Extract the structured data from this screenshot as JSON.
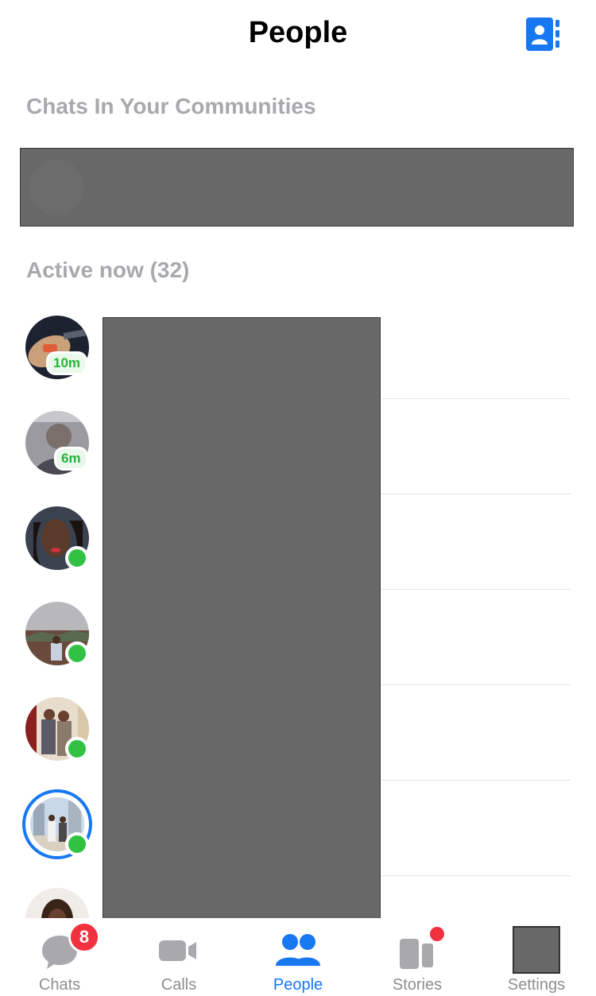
{
  "header": {
    "title": "People"
  },
  "communities": {
    "title": "Chats In Your Communities"
  },
  "active": {
    "title": "Active now (32)",
    "people": [
      {
        "status": "time",
        "time": "10m"
      },
      {
        "status": "time",
        "time": "6m"
      },
      {
        "status": "online"
      },
      {
        "status": "online"
      },
      {
        "status": "online"
      },
      {
        "status": "online",
        "story_ring": true
      },
      {
        "status": "unknown"
      }
    ]
  },
  "tabs": [
    {
      "label": "Chats",
      "badge": "8"
    },
    {
      "label": "Calls"
    },
    {
      "label": "People",
      "active": true
    },
    {
      "label": "Stories"
    },
    {
      "label": "Settings"
    }
  ],
  "colors": {
    "accent": "#1778f2",
    "online": "#31c244",
    "badge": "#f2313e"
  }
}
